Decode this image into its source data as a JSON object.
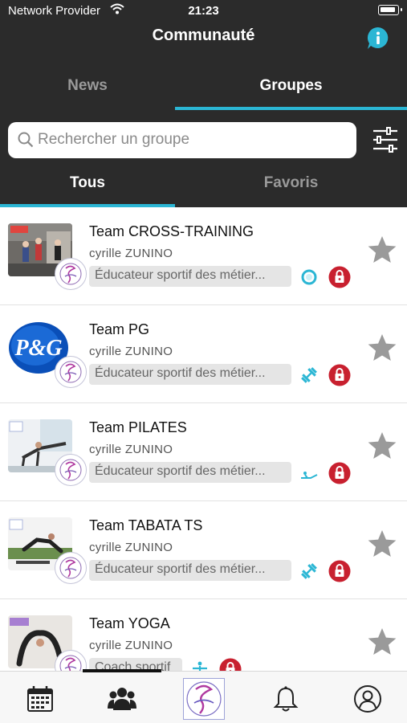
{
  "status_bar": {
    "carrier": "Network Provider",
    "time": "21:23"
  },
  "header": {
    "title": "Communauté"
  },
  "tabs": [
    {
      "label": "News",
      "active": false
    },
    {
      "label": "Groupes",
      "active": true
    }
  ],
  "search": {
    "placeholder": "Rechercher un groupe"
  },
  "subtabs": [
    {
      "label": "Tous",
      "active": true
    },
    {
      "label": "Favoris",
      "active": false
    }
  ],
  "groups": [
    {
      "name": "Team CROSS-TRAINING",
      "owner": "cyrille  ZUNINO",
      "category": "Éducateur sportif des métier...",
      "activity_icon": "ring-icon",
      "locked": true,
      "favorite": false
    },
    {
      "name": "Team PG",
      "owner": "cyrille  ZUNINO",
      "category": "Éducateur sportif des métier...",
      "activity_icon": "dumbbell-icon",
      "locked": true,
      "favorite": false,
      "thumb_text": "P&G"
    },
    {
      "name": "Team PILATES",
      "owner": "cyrille  ZUNINO",
      "category": "Éducateur sportif des métier...",
      "activity_icon": "pilates-icon",
      "locked": true,
      "favorite": false
    },
    {
      "name": "Team TABATA TS",
      "owner": "cyrille  ZUNINO",
      "category": "Éducateur sportif des métier...",
      "activity_icon": "dumbbell-icon",
      "locked": true,
      "favorite": false
    },
    {
      "name": "Team YOGA",
      "owner": "cyrille  ZUNINO",
      "category": "Coach sportif",
      "activity_icon": "yoga-icon",
      "locked": true,
      "favorite": false
    }
  ],
  "tabbar": [
    {
      "icon": "calendar-icon"
    },
    {
      "icon": "community-icon",
      "active": true
    },
    {
      "icon": "app-logo-icon"
    },
    {
      "icon": "bell-icon"
    },
    {
      "icon": "profile-icon"
    }
  ],
  "colors": {
    "accent": "#2bb6d4",
    "lock": "#c8202f",
    "header_bg": "#2b2b2b",
    "star": "#9a9a9a"
  }
}
